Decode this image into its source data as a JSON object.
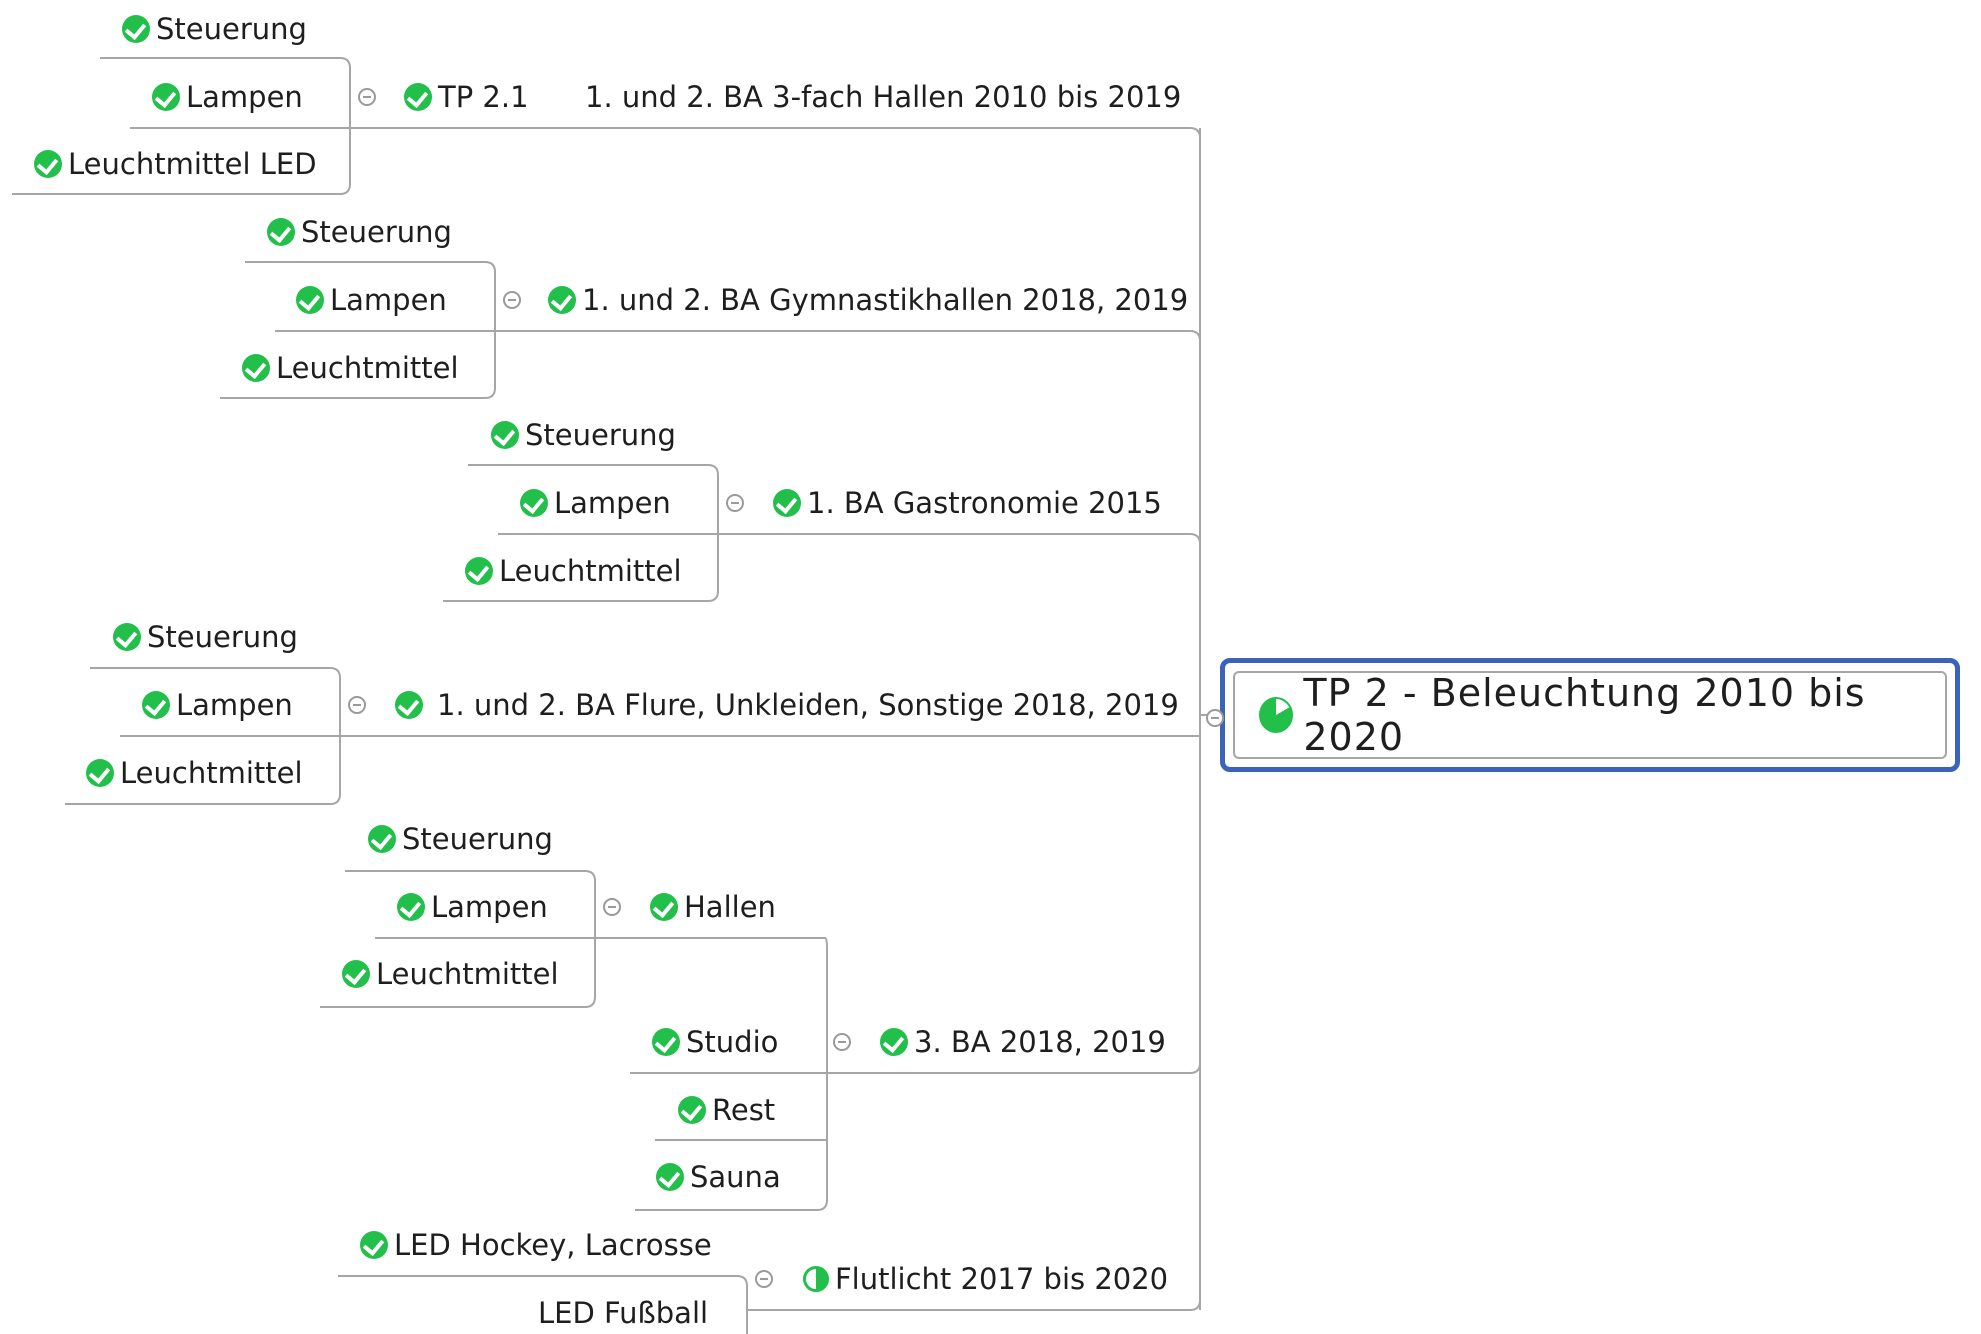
{
  "central_topic": {
    "label": "TP 2 - Beleuchtung 2010 bis 2020",
    "icon": "pie-progress-icon"
  },
  "branches": [
    {
      "label": "1. und 2. BA 3-fach Hallen 2010 bis 2019",
      "tag": "TP 2.1",
      "children": [
        "Steuerung",
        "Lampen",
        "Leuchtmittel LED"
      ]
    },
    {
      "label": "1. und 2. BA Gymnastikhallen 2018, 2019",
      "children": [
        "Steuerung",
        "Lampen",
        "Leuchtmittel"
      ]
    },
    {
      "label": "1. BA Gastronomie 2015",
      "children": [
        "Steuerung",
        "Lampen",
        "Leuchtmittel"
      ]
    },
    {
      "label": "1.  und 2. BA Flure, Unkleiden, Sonstige 2018, 2019",
      "children": [
        "Steuerung",
        "Lampen",
        "Leuchtmittel"
      ]
    },
    {
      "label": "3. BA 2018, 2019",
      "children": [
        {
          "label": "Hallen",
          "children": [
            "Steuerung",
            "Lampen",
            "Leuchtmittel"
          ]
        },
        "Studio",
        "Rest",
        "Sauna"
      ]
    },
    {
      "label": "Flutlicht 2017 bis 2020",
      "status": "half-progress-icon",
      "children": [
        "LED Hockey, Lacrosse",
        "LED Fußball"
      ]
    }
  ],
  "colors": {
    "check": "#22bf4b",
    "central_border": "#3b63b8",
    "line": "#a6a6a6"
  }
}
